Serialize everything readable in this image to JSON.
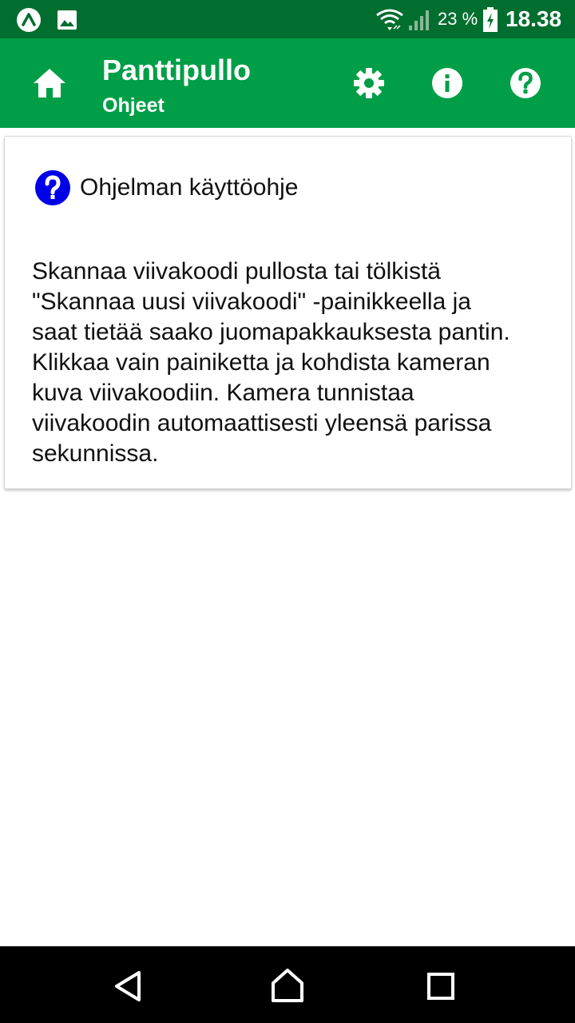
{
  "status_bar": {
    "icons": [
      "app-notification-icon",
      "image-notification-icon",
      "wifi-icon",
      "cellular-signal-icon",
      "battery-charging-icon"
    ],
    "battery_percent": "23 %",
    "time": "18.38"
  },
  "app_bar": {
    "title": "Panttipullo",
    "subtitle": "Ohjeet",
    "icons": [
      "home-icon",
      "gear-icon",
      "info-icon",
      "help-icon"
    ]
  },
  "card": {
    "icon": "question-circle-icon",
    "title": "Ohjelman käyttöohje",
    "body": "Skannaa viivakoodi pullosta tai tölkistä\n\"Skannaa uusi viivakoodi\" -painikkeella ja\nsaat tietää saako juomapakkauksesta pantin.\nKlikkaa vain painiketta ja kohdista kameran\nkuva viivakoodiin. Kamera tunnistaa\nviivakoodin automaattisesti yleensä parissa\nsekunnissa."
  },
  "nav_bar": {
    "icons": [
      "back-icon",
      "home-outline-icon",
      "recents-icon"
    ]
  },
  "colors": {
    "status_bar": "#006e2e",
    "app_bar": "#009e47",
    "card_icon": "#0000e6",
    "nav_bar": "#000000"
  }
}
